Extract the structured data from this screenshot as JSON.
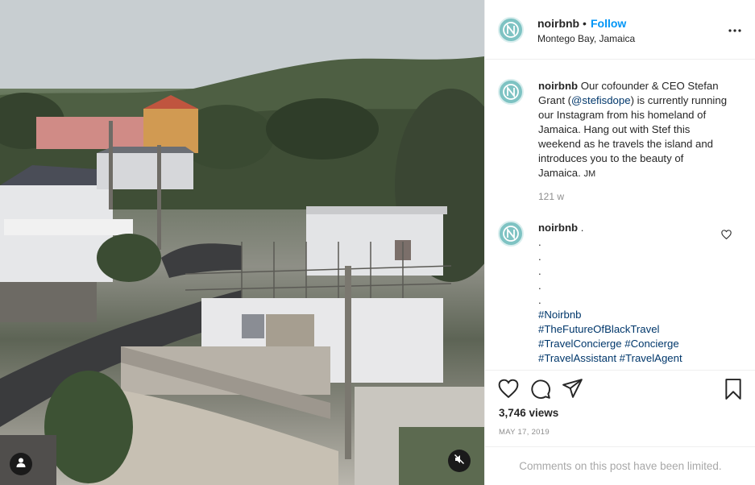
{
  "post": {
    "username": "noirbnb",
    "separator": "•",
    "follow_label": "Follow",
    "location": "Montego Bay, Jamaica"
  },
  "caption": {
    "username": "noirbnb",
    "text_before_mention": " Our cofounder & CEO Stefan Grant (",
    "mention": "@stefisdope",
    "text_after_mention": ") is currently running our Instagram from his homeland of Jamaica. Hang out with Stef this weekend as he travels the island and introduces you to the beauty of Jamaica.",
    "signoff": "JM",
    "age": "121 w"
  },
  "comment": {
    "username": "noirbnb",
    "dots": [
      ".",
      ".",
      ".",
      ".",
      ".",
      "."
    ],
    "hashtags": [
      "#Noirbnb",
      "#TheFutureOfBlackTravel",
      "#TravelConcierge",
      "#Concierge",
      "#TravelAssistant",
      "#TravelAgent"
    ]
  },
  "stats": {
    "views": "3,746 views",
    "date": "MAY 17, 2019",
    "comments_limited": "Comments on this post have been limited."
  },
  "icons": {
    "like": "heart-icon",
    "comment": "comment-icon",
    "share": "paper-plane-icon",
    "save": "bookmark-icon",
    "more": "more-options-icon",
    "user_tags": "user-icon",
    "mute": "muted-speaker-icon",
    "brand_logo": "noirbnb-logo-icon"
  },
  "colors": {
    "link_blue": "#0095f6",
    "hashtag": "#00376b",
    "avatar_teal": "#7ec3c3",
    "muted_text": "#8e8e8e"
  }
}
